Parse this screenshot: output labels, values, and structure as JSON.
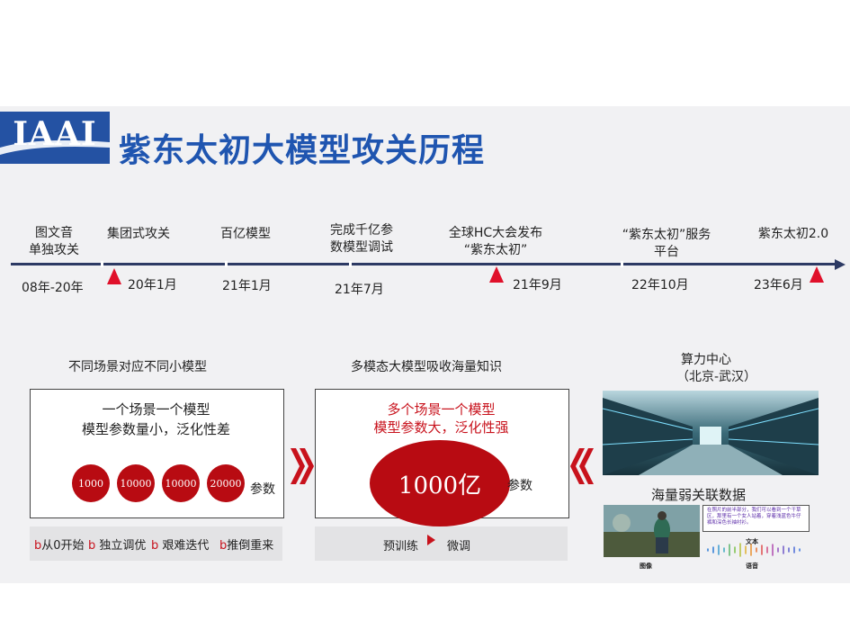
{
  "header": {
    "logo_text": "IAAI",
    "title": "紫东太初大模型攻关历程"
  },
  "timeline": {
    "milestones": [
      {
        "label": "图文音\n单独攻关",
        "date": "08年-20年"
      },
      {
        "label": "集团式攻关",
        "date": "20年1月"
      },
      {
        "label": "百亿模型",
        "date": "21年1月"
      },
      {
        "label": "完成千亿参\n数模型调试",
        "date": "21年7月"
      },
      {
        "label": "全球HC大会发布\n“紫东太初”",
        "date": "21年9月"
      },
      {
        "label": "“紫东太初”服务\n平台",
        "date": "22年10月"
      },
      {
        "label": "紫东太初2.0",
        "date": "23年6月"
      }
    ],
    "colors": {
      "axis": "#2d3a64",
      "marker": "#e0102a"
    }
  },
  "left_panel": {
    "title": "不同场景对应不同小模型",
    "line1": "一个场景一个模型",
    "line2": "模型参数量小，泛化性差",
    "params": [
      "1000",
      "10000",
      "10000",
      "20000"
    ],
    "unit": "参数",
    "bar_items": [
      {
        "bullet": "b",
        "text": "从0开始"
      },
      {
        "bullet": "b",
        "text": " 独立调优"
      },
      {
        "bullet": "b",
        "text": " 艰难迭代"
      },
      {
        "bullet": "b",
        "text": "推倒重来"
      }
    ]
  },
  "middle_panel": {
    "title": "多模态大模型吸收海量知识",
    "line1": "多个场景一个模型",
    "line2": "模型参数大，泛化性强",
    "param": "1000亿",
    "unit": "参数",
    "bar_left": "预训练",
    "bar_right": "微调"
  },
  "right_panel": {
    "title_line1": "算力中心",
    "title_line2": "（北京-武汉）",
    "data_title": "海量弱关联数据",
    "text_card": "在照片的前半部分，我们可以看到一个干草区，那里有一个女人站着，穿着浅蓝色牛仔裤和深色长袖衬衫。",
    "label_image": "图像",
    "label_text": "文本",
    "label_audio": "语音"
  },
  "colors": {
    "brand_blue": "#1f55b0",
    "dark_red": "#b80b12",
    "accent_red": "#c8121c"
  }
}
